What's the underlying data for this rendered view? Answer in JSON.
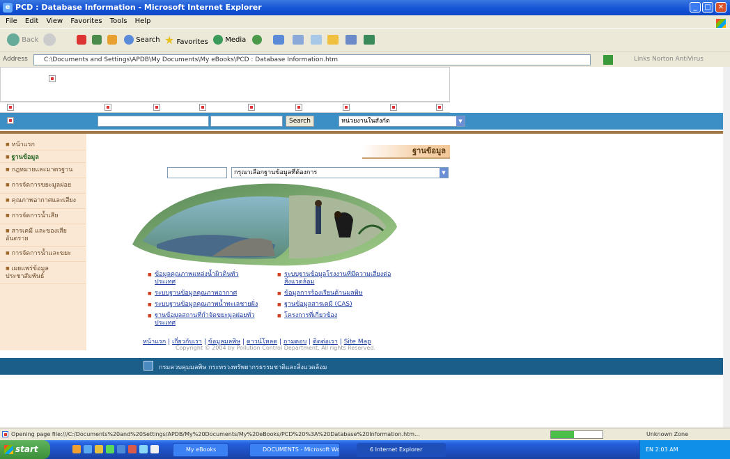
{
  "window": {
    "title": "PCD : Database Information - Microsoft Internet Explorer",
    "min": "_",
    "max": "□",
    "close": "✕"
  },
  "menu": [
    "File",
    "Edit",
    "View",
    "Favorites",
    "Tools",
    "Help"
  ],
  "toolbar": {
    "back": "Back",
    "search": "Search",
    "favorites": "Favorites",
    "media": "Media"
  },
  "address": {
    "label": "Address",
    "value": "C:\\Documents and Settings\\APDB\\My Documents\\My eBooks\\PCD : Database Information.htm",
    "go": "Go",
    "links": "Links  Norton AntiVirus"
  },
  "page": {
    "search_button": "Search",
    "search_scope": "หน่วยงานในสังกัด",
    "title": "ฐานข้อมูล",
    "db_select": "กรุณาเลือกฐานข้อมูลที่ต้องการ",
    "sidebar": [
      "หน้าแรก",
      "ฐานข้อมูล",
      "กฎหมายและมาตรฐาน",
      "การจัดการขยะมูลฝอย",
      "คุณภาพอากาศและเสียง",
      "การจัดการน้ำเสีย",
      "สารเคมี และของเสียอันตราย",
      "การจัดการน้ำและขยะ",
      "เผยแพร่ข้อมูล ประชาสัมพันธ์"
    ],
    "links_left": [
      "ข้อมูลคุณภาพแหล่งน้ำผิวดินทั่วประเทศ",
      "ระบบฐานข้อมูลคุณภาพอากาศ",
      "ระบบฐานข้อมูลคุณภาพน้ำทะเลชายฝั่ง",
      "ฐานข้อมูลสถานที่กำจัดขยะมูลฝอยทั่วประเทศ"
    ],
    "links_right": [
      "ระบบฐานข้อมูลโรงงานที่มีความเสี่ยงต่อสิ่งแวดล้อม",
      "ข้อมูลการร้องเรียนด้านมลพิษ",
      "ฐานข้อมูลสารเคมี (CAS)",
      "โครงการที่เกี่ยวข้อง"
    ],
    "footer_links": [
      "หน้าแรก",
      "เกี่ยวกับเรา",
      "ข้อมูลมลพิษ",
      "ดาวน์โหลด",
      "ถามตอบ",
      "ติดต่อเรา",
      "Site Map"
    ],
    "copyright": "Copyright © 2004 by Pollution Control Department. All rights Reserved.",
    "footbar_text": "กรมควบคุมมลพิษ กระทรวงทรัพยากรธรรมชาติและสิ่งแวดล้อม"
  },
  "status": {
    "text": "Opening page file:///C:/Documents%20and%20Settings/APDB/My%20Documents/My%20eBooks/PCD%20%3A%20Database%20Information.htm...",
    "progress": 0.45,
    "zone": "Unknown Zone"
  },
  "taskbar": {
    "start": "start",
    "buttons": [
      "My eBooks",
      "DOCUMENTS - Microsoft Word",
      "6 Internet Explorer"
    ],
    "tray": "EN  2:03 AM"
  }
}
